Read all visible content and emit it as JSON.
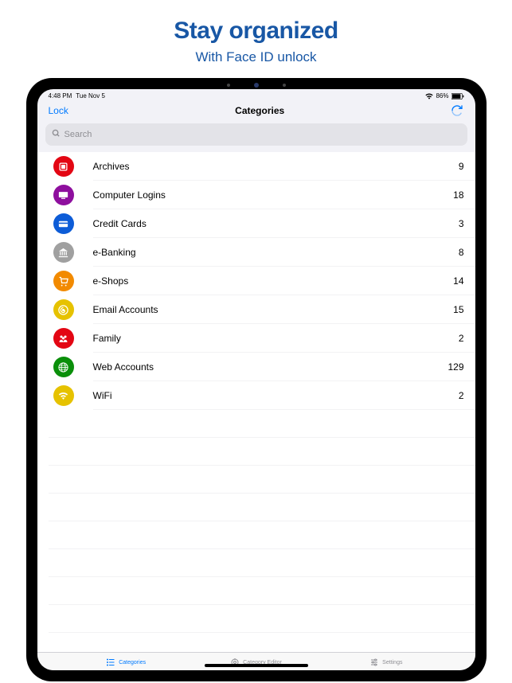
{
  "header": {
    "title": "Stay organized",
    "subtitle": "With Face ID unlock"
  },
  "statusBar": {
    "time": "4:48 PM",
    "date": "Tue Nov 5",
    "battery": "86%"
  },
  "navBar": {
    "leftLabel": "Lock",
    "title": "Categories"
  },
  "search": {
    "placeholder": "Search"
  },
  "categories": [
    {
      "label": "Archives",
      "count": "9",
      "color": "#e30613",
      "icon": "archive"
    },
    {
      "label": "Computer Logins",
      "count": "18",
      "color": "#8e0f9e",
      "icon": "computer"
    },
    {
      "label": "Credit Cards",
      "count": "3",
      "color": "#0d5cd7",
      "icon": "card"
    },
    {
      "label": "e-Banking",
      "count": "8",
      "color": "#a0a0a0",
      "icon": "bank"
    },
    {
      "label": "e-Shops",
      "count": "14",
      "color": "#f28a00",
      "icon": "cart"
    },
    {
      "label": "Email Accounts",
      "count": "15",
      "color": "#e6c200",
      "icon": "email"
    },
    {
      "label": "Family",
      "count": "2",
      "color": "#e30613",
      "icon": "family"
    },
    {
      "label": "Web Accounts",
      "count": "129",
      "color": "#0a8f0a",
      "icon": "globe"
    },
    {
      "label": "WiFi",
      "count": "2",
      "color": "#e6c200",
      "icon": "wifi"
    }
  ],
  "tabs": [
    {
      "label": "Categories",
      "active": true
    },
    {
      "label": "Category Editor",
      "active": false
    },
    {
      "label": "Settings",
      "active": false
    }
  ]
}
